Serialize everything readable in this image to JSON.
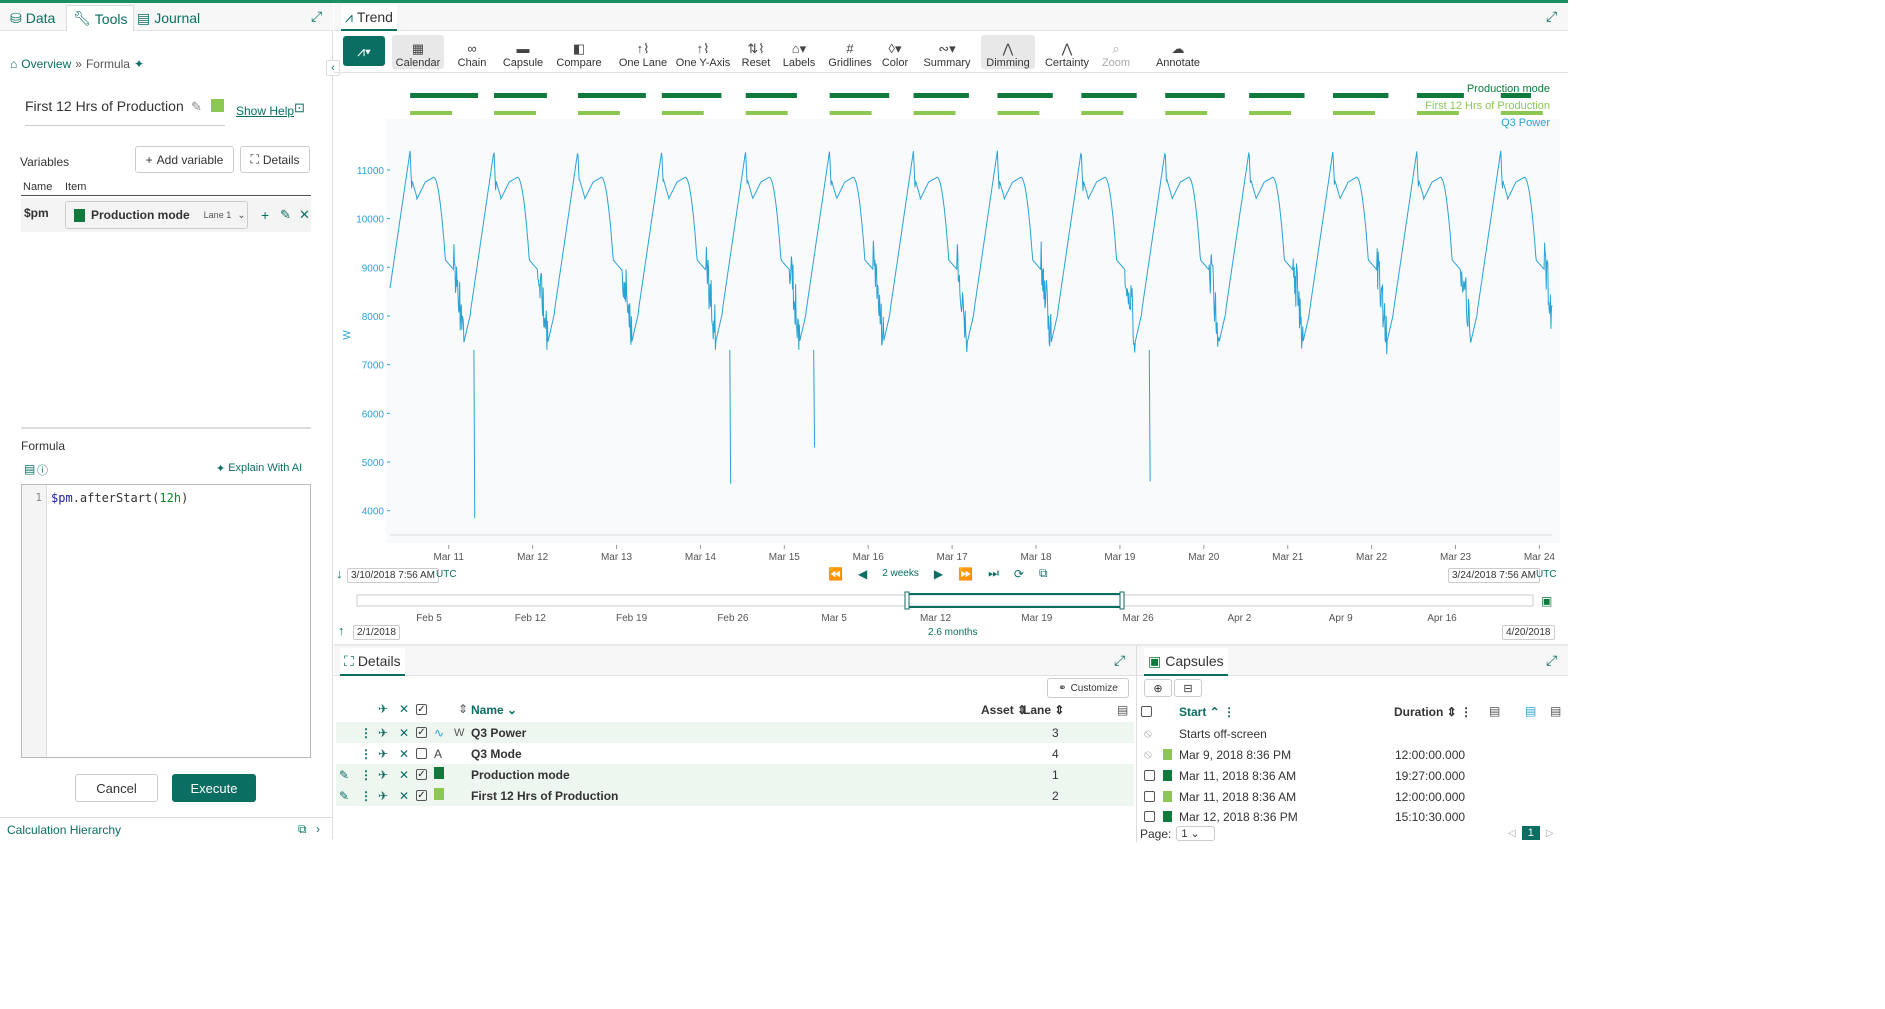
{
  "left_tabs": [
    {
      "label": "Data"
    },
    {
      "label": "Tools"
    },
    {
      "label": "Journal"
    }
  ],
  "breadcrumb": {
    "overview": "Overview",
    "separator": "»",
    "current": "Formula"
  },
  "formula_name": "First 12 Hrs of Production",
  "show_help": "Show Help",
  "variables": {
    "label": "Variables",
    "add_label": "Add variable",
    "details_label": "Details",
    "col_name": "Name",
    "col_item": "Item",
    "rows": [
      {
        "name": "$pm",
        "item": "Production mode",
        "lane": "Lane 1"
      }
    ]
  },
  "formula": {
    "label": "Formula",
    "explain": "Explain With AI",
    "line_no": "1",
    "var": "$pm",
    "fn": ".afterStart(",
    "arg": "12h",
    ",close": ")",
    "close": ")"
  },
  "buttons": {
    "cancel": "Cancel",
    "execute": "Execute"
  },
  "calc_hierarchy": "Calculation Hierarchy",
  "trend_tab": "Trend",
  "toolbar": [
    {
      "label": "Calendar",
      "icon": "▦",
      "selected": true
    },
    {
      "label": "Chain",
      "icon": "∞"
    },
    {
      "label": "Capsule",
      "icon": "▬"
    },
    {
      "label": "Compare",
      "icon": "◧"
    },
    {
      "label": "One Lane",
      "icon": "↑⌇"
    },
    {
      "label": "One Y-Axis",
      "icon": "↑⌇"
    },
    {
      "label": "Reset",
      "icon": "⇅⌇"
    },
    {
      "label": "Labels",
      "icon": "⌂▾"
    },
    {
      "label": "Gridlines",
      "icon": "#"
    },
    {
      "label": "Color",
      "icon": "◊▾"
    },
    {
      "label": "Summary",
      "icon": "∾▾"
    },
    {
      "label": "Dimming",
      "icon": "⋀",
      "selected": true
    },
    {
      "label": "Certainty",
      "icon": "⋀"
    },
    {
      "label": "Zoom",
      "icon": "⌕",
      "disabled": true
    },
    {
      "label": "Annotate",
      "icon": "☁"
    }
  ],
  "legend": {
    "production": "Production mode",
    "first12": "First 12 Hrs of Production",
    "power": "Q3 Power"
  },
  "colors": {
    "dark_green": "#0f7a3c",
    "light_green": "#8cc751",
    "series": "#29a3d6",
    "teal": "#0b6e63"
  },
  "chart_data": {
    "type": "line",
    "ylabel": "W",
    "y_ticks": [
      "11000",
      "10000",
      "9000",
      "8000",
      "7000",
      "6000",
      "5000",
      "4000"
    ],
    "x_ticks": [
      "Mar 11",
      "Mar 12",
      "Mar 13",
      "Mar 14",
      "Mar 15",
      "Mar 16",
      "Mar 17",
      "Mar 18",
      "Mar 19",
      "Mar 20",
      "Mar 21",
      "Mar 22",
      "Mar 23",
      "Mar 24"
    ],
    "ylim": [
      3500,
      11800
    ],
    "xlim": [
      10.3,
      24.15
    ],
    "x_unit": "day of March 2018",
    "cycle_starts": [
      10.54,
      11.54,
      12.54,
      13.54,
      14.54,
      15.54,
      16.54,
      17.54,
      18.54,
      19.54,
      20.54,
      21.54,
      22.54,
      23.54
    ],
    "production_capsules": [
      [
        10.0,
        10.3
      ],
      [
        10.54,
        11.35
      ],
      [
        11.54,
        12.17
      ],
      [
        12.54,
        13.35
      ],
      [
        13.54,
        14.25
      ],
      [
        14.54,
        15.15
      ],
      [
        15.54,
        16.25
      ],
      [
        16.54,
        17.2
      ],
      [
        17.54,
        18.2
      ],
      [
        18.54,
        19.2
      ],
      [
        19.54,
        20.25
      ],
      [
        20.54,
        21.2
      ],
      [
        21.54,
        22.2
      ],
      [
        22.54,
        23.1
      ],
      [
        23.54,
        23.9
      ]
    ],
    "first12_capsules": [
      [
        10.0,
        10.3
      ],
      [
        10.54,
        11.04
      ],
      [
        11.54,
        12.04
      ],
      [
        12.54,
        13.04
      ],
      [
        13.54,
        14.04
      ],
      [
        14.54,
        15.04
      ],
      [
        15.54,
        16.04
      ],
      [
        16.54,
        17.04
      ],
      [
        17.54,
        18.04
      ],
      [
        18.54,
        19.04
      ],
      [
        19.54,
        20.04
      ],
      [
        20.54,
        21.04
      ],
      [
        21.54,
        22.04
      ],
      [
        22.54,
        23.04
      ],
      [
        23.54,
        24.04
      ]
    ],
    "series": [
      {
        "name": "Q3 Power"
      }
    ]
  },
  "range": {
    "start": "3/10/2018 7:56 AM",
    "end": "3/24/2018 7:56 AM",
    "tz": "UTC",
    "duration": "2 weeks"
  },
  "nav": {
    "ticks": [
      "Feb 5",
      "Feb 12",
      "Feb 19",
      "Feb 26",
      "Mar 5",
      "Mar 12",
      "Mar 19",
      "Mar 26",
      "Apr 2",
      "Apr 9",
      "Apr 16"
    ],
    "start": "2/1/2018",
    "end": "4/20/2018",
    "span": "2.6 months"
  },
  "details": {
    "tab": "Details",
    "customize": "Customize",
    "cols": {
      "name": "Name",
      "asset": "Asset",
      "lane": "Lane"
    },
    "rows": [
      {
        "name": "Q3 Power",
        "unit": "W",
        "lane": "3",
        "checked": true
      },
      {
        "name": "Q3 Mode",
        "unit": "",
        "lane": "4",
        "checked": false
      },
      {
        "name": "Production mode",
        "unit": "",
        "lane": "1",
        "checked": true
      },
      {
        "name": "First 12 Hrs of Production",
        "unit": "",
        "lane": "2",
        "checked": true
      }
    ]
  },
  "capsules": {
    "tab": "Capsules",
    "col_start": "Start",
    "col_duration": "Duration",
    "rows": [
      {
        "start": "Starts off-screen",
        "duration": ""
      },
      {
        "start": "Mar 9, 2018 8:36 PM",
        "duration": "12:00:00.000"
      },
      {
        "start": "Mar 11, 2018 8:36 AM",
        "duration": "19:27:00.000"
      },
      {
        "start": "Mar 11, 2018 8:36 AM",
        "duration": "12:00:00.000"
      },
      {
        "start": "Mar 12, 2018 8:36 PM",
        "duration": "15:10:30.000"
      }
    ],
    "page_label": "Page:",
    "page_value": "1",
    "page_current": "1"
  }
}
